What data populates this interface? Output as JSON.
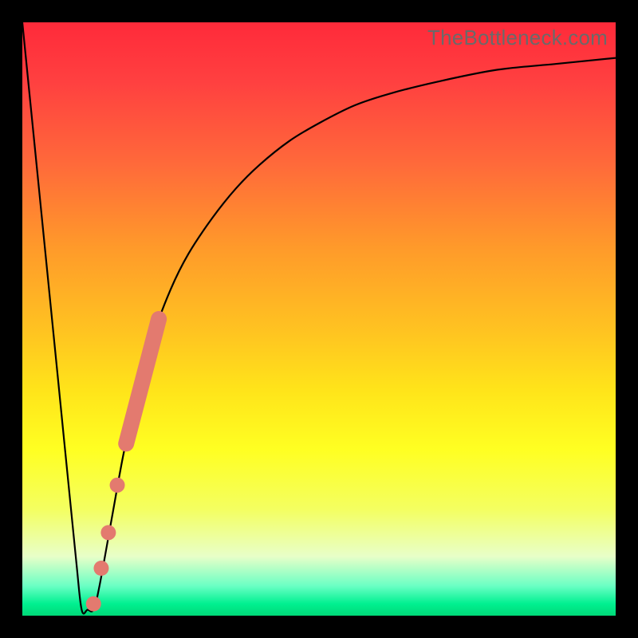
{
  "watermark": "TheBottleneck.com",
  "colors": {
    "frame": "#000000",
    "curve": "#000000",
    "marker": "#e37a6f"
  },
  "chart_data": {
    "type": "line",
    "title": "",
    "xlabel": "",
    "ylabel": "",
    "xlim": [
      0,
      100
    ],
    "ylim": [
      0,
      100
    ],
    "grid": false,
    "legend": false,
    "series": [
      {
        "name": "bottleneck_curve",
        "x": [
          0,
          3,
          6,
          9,
          10,
          11,
          12,
          13,
          15,
          17,
          19,
          22,
          25,
          28,
          32,
          36,
          40,
          45,
          50,
          56,
          62,
          70,
          80,
          90,
          100
        ],
        "y": [
          100,
          70,
          40,
          10,
          1,
          1,
          1,
          5,
          16,
          27,
          36,
          47,
          55,
          61,
          67,
          72,
          76,
          80,
          83,
          86,
          88,
          90,
          92,
          93,
          94
        ]
      }
    ],
    "markers": [
      {
        "name": "long_segment",
        "x_range": [
          17.5,
          23.0
        ],
        "y_range": [
          29,
          50
        ]
      },
      {
        "name": "dot_1",
        "x": 16.0,
        "y": 22
      },
      {
        "name": "dot_2",
        "x": 14.5,
        "y": 14
      },
      {
        "name": "dot_3",
        "x": 13.3,
        "y": 8
      },
      {
        "name": "dot_4",
        "x": 12.0,
        "y": 2
      }
    ],
    "background_gradient": {
      "top": "#ff2a3a",
      "mid": "#ffff22",
      "bottom": "#00d978"
    }
  }
}
